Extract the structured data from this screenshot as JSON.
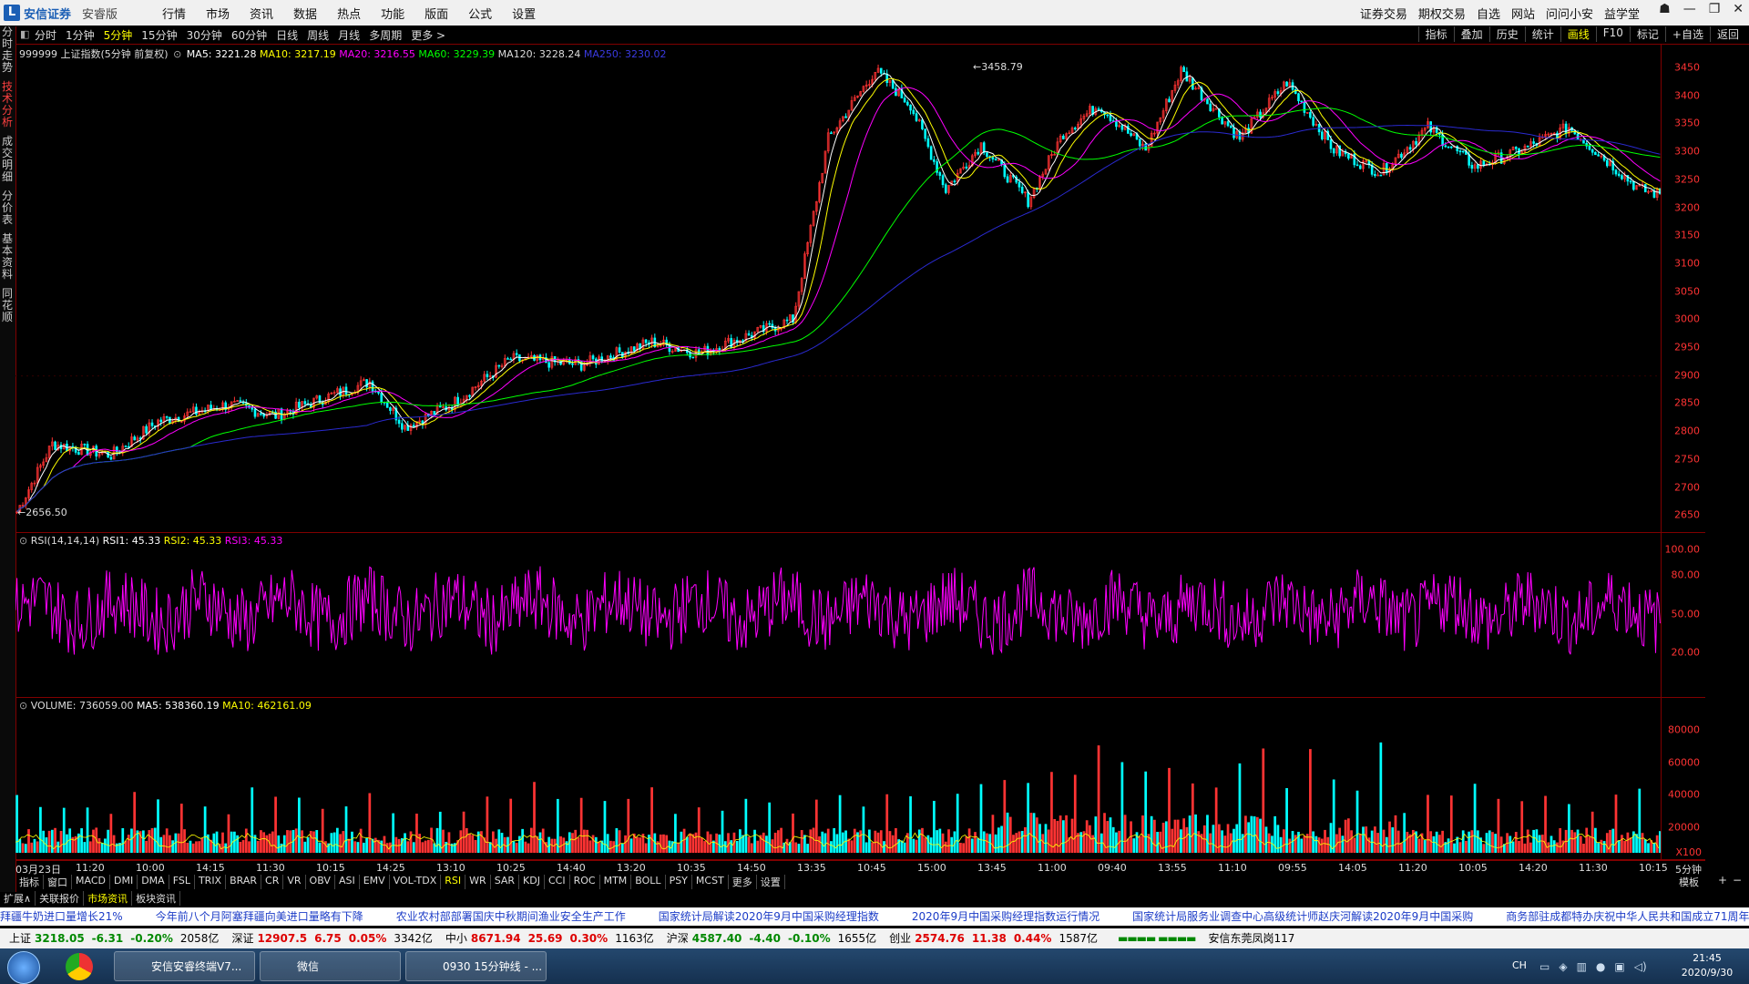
{
  "app": {
    "brand": "安信证券",
    "edition": "安睿版"
  },
  "menu": [
    "行情",
    "市场",
    "资讯",
    "数据",
    "热点",
    "功能",
    "版面",
    "公式",
    "设置"
  ],
  "right_menu": [
    "证券交易",
    "期权交易",
    "自选",
    "网站",
    "问问小安",
    "益学堂"
  ],
  "periods": [
    "分时",
    "1分钟",
    "5分钟",
    "15分钟",
    "30分钟",
    "60分钟",
    "日线",
    "周线",
    "月线",
    "多周期",
    "更多 >"
  ],
  "active_period": "5分钟",
  "right_tools": [
    "指标",
    "叠加",
    "历史",
    "统计",
    "画线",
    "F10",
    "标记",
    "+自选",
    "返回"
  ],
  "left_tabs": [
    "分时走势",
    "技术分析",
    "成交明细",
    "分价表",
    "基本资料",
    "同花顺"
  ],
  "price_legend": {
    "code": "999999 上证指数(5分钟 前复权)",
    "ma5": "MA5: 3221.28",
    "ma10": "MA10: 3217.19",
    "ma20": "MA20: 3216.55",
    "ma60": "MA60: 3229.39",
    "ma120": "MA120: 3228.24",
    "ma250": "MA250: 3230.02"
  },
  "price_annotations": {
    "high": "3458.79",
    "low": "2656.50"
  },
  "price_axis": [
    "3450",
    "3400",
    "3350",
    "3300",
    "3250",
    "3200",
    "3150",
    "3100",
    "3050",
    "3000",
    "2950",
    "2900",
    "2850",
    "2800",
    "2750",
    "2700",
    "2650"
  ],
  "rsi_legend": {
    "title": "RSI(14,14,14)",
    "rsi1": "RSI1: 45.33",
    "rsi2": "RSI2: 45.33",
    "rsi3": "RSI3: 45.33"
  },
  "rsi_axis": [
    "100.00",
    "80.00",
    "50.00",
    "20.00"
  ],
  "vol_legend": {
    "title": "VOLUME: 736059.00",
    "ma5": "MA5: 538360.19",
    "ma10": "MA10: 462161.09"
  },
  "vol_axis": [
    "80000",
    "60000",
    "40000",
    "20000"
  ],
  "vol_unit": "X100",
  "time_axis": [
    "03月23日",
    "11:20",
    "10:00",
    "14:15",
    "11:30",
    "10:15",
    "14:25",
    "13:10",
    "10:25",
    "14:40",
    "13:20",
    "10:35",
    "14:50",
    "13:35",
    "10:45",
    "15:00",
    "13:45",
    "11:00",
    "09:40",
    "13:55",
    "11:10",
    "09:55",
    "14:05",
    "11:20",
    "10:05",
    "14:20",
    "11:30",
    "10:15"
  ],
  "period_label": "5分钟",
  "indicators": [
    "指标",
    "窗口",
    "MACD",
    "DMI",
    "DMA",
    "FSL",
    "TRIX",
    "BRAR",
    "CR",
    "VR",
    "OBV",
    "ASI",
    "EMV",
    "VOL-TDX",
    "RSI",
    "WR",
    "SAR",
    "KDJ",
    "CCI",
    "ROC",
    "MTM",
    "BOLL",
    "PSY",
    "MCST",
    "更多",
    "设置"
  ],
  "active_indicator": "RSI",
  "template_label": "模板",
  "sub_tabs": [
    "扩展∧",
    "关联报价",
    "市场资讯",
    "板块资讯"
  ],
  "active_sub_tab": "市场资讯",
  "news": [
    "拜疆牛奶进口量增长21%",
    "今年前八个月阿塞拜疆向美进口量略有下降",
    "农业农村部部署国庆中秋期间渔业安全生产工作",
    "国家统计局解读2020年9月中国采购经理指数",
    "2020年9月中国采购经理指数运行情况",
    "国家统计局服务业调查中心高级统计师赵庆河解读2020年9月中国采购",
    "商务部驻成都特办庆祝中华人民共和国成立71周年!"
  ],
  "quotes": [
    {
      "name": "上证",
      "price": "3218.05",
      "chg": "-6.31",
      "pct": "-0.20%",
      "amt": "2058亿",
      "dir": "dn"
    },
    {
      "name": "深证",
      "price": "12907.5",
      "chg": "6.75",
      "pct": "0.05%",
      "amt": "3342亿",
      "dir": "up"
    },
    {
      "name": "中小",
      "price": "8671.94",
      "chg": "25.69",
      "pct": "0.30%",
      "amt": "1163亿",
      "dir": "up"
    },
    {
      "name": "沪深",
      "price": "4587.40",
      "chg": "-4.40",
      "pct": "-0.10%",
      "amt": "1655亿",
      "dir": "dn"
    },
    {
      "name": "创业",
      "price": "2574.76",
      "chg": "11.38",
      "pct": "0.44%",
      "amt": "1587亿",
      "dir": "up"
    }
  ],
  "broker": "安信东莞凤岗117",
  "taskbar": {
    "items": [
      "安信安睿终端V7...",
      "微信",
      "0930 15分钟线 - ..."
    ],
    "clock_time": "21:45",
    "clock_date": "2020/9/30",
    "ime": "CH"
  },
  "colors": {
    "up": "#ff3333",
    "down": "#00ffff",
    "ma5": "#ffffff",
    "ma10": "#ffff00",
    "ma20": "#ff00ff",
    "ma60": "#00ff00",
    "ma120": "#dddddd",
    "ma250": "#2a2ad0",
    "rsi": "#ff00ff",
    "grid": "#800000"
  }
}
